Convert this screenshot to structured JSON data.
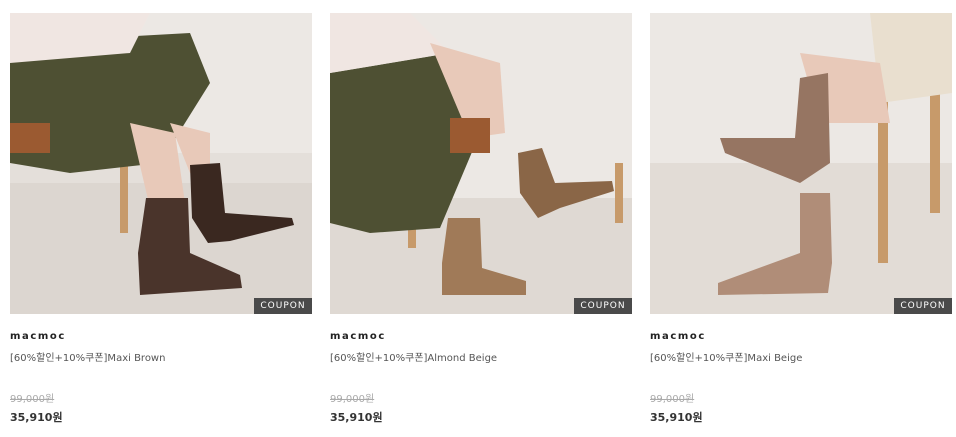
{
  "products": [
    {
      "brand": "macmoc",
      "name": "[60%할인+10%쿠폰]Maxi Brown",
      "original_price": "99,000원",
      "sale_price": "35,910원",
      "badge": "COUPON",
      "boot_color": "#4a342b",
      "boot_shade": "#3a2820"
    },
    {
      "brand": "macmoc",
      "name": "[60%할인+10%쿠폰]Almond Beige",
      "original_price": "99,000원",
      "sale_price": "35,910원",
      "badge": "COUPON",
      "boot_color": "#a07a58",
      "boot_shade": "#8a6647"
    },
    {
      "brand": "macmoc",
      "name": "[60%할인+10%쿠폰]Maxi Beige",
      "original_price": "99,000원",
      "sale_price": "35,910원",
      "badge": "COUPON",
      "boot_color": "#b08d78",
      "boot_shade": "#967562"
    }
  ],
  "colors": {
    "badge_bg": "#4a4a4a",
    "strike_price": "#aaaaaa"
  }
}
